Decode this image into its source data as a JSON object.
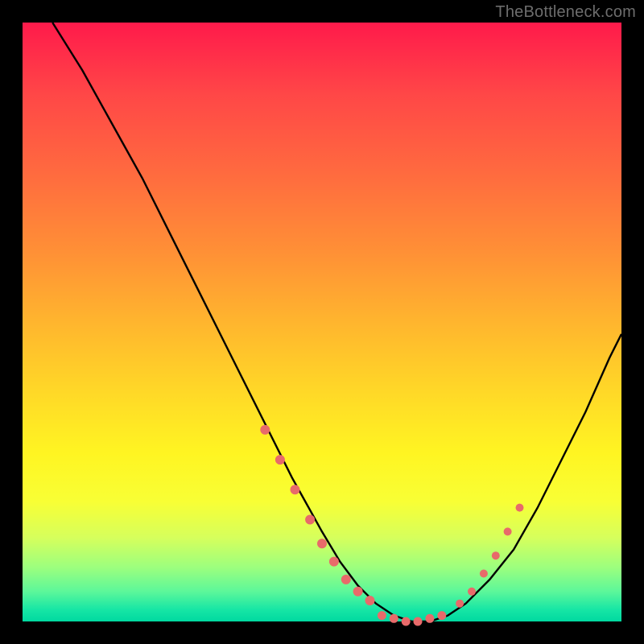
{
  "attribution": "TheBottleneck.com",
  "colors": {
    "page_bg": "#000000",
    "curve_stroke": "#000000",
    "marker_fill": "#e86a6a",
    "gradient_top": "#ff1a4b",
    "gradient_bottom": "#00d9a0"
  },
  "chart_data": {
    "type": "line",
    "title": "",
    "xlabel": "",
    "ylabel": "",
    "xlim": [
      0,
      100
    ],
    "ylim": [
      0,
      100
    ],
    "grid": false,
    "legend": null,
    "series": [
      {
        "name": "bottleneck-curve",
        "x": [
          5,
          10,
          15,
          20,
          25,
          30,
          35,
          40,
          45,
          50,
          53,
          56,
          59,
          62,
          65,
          68,
          71,
          74,
          78,
          82,
          86,
          90,
          94,
          98,
          100
        ],
        "values": [
          100,
          92,
          83,
          74,
          64,
          54,
          44,
          34,
          24,
          15,
          10,
          6,
          3,
          1,
          0,
          0,
          1,
          3,
          7,
          12,
          19,
          27,
          35,
          44,
          48
        ]
      }
    ],
    "markers_left": {
      "x": [
        40.5,
        43,
        45.5,
        48,
        50,
        52,
        54,
        56,
        58
      ],
      "values": [
        32,
        27,
        22,
        17,
        13,
        10,
        7,
        5,
        3.5
      ]
    },
    "markers_right": {
      "x": [
        73,
        75,
        77,
        79,
        81,
        83
      ],
      "values": [
        3,
        5,
        8,
        11,
        15,
        19
      ]
    },
    "floor_dots": {
      "x": [
        60,
        62,
        64,
        66,
        68,
        70
      ],
      "values": [
        1,
        0.5,
        0,
        0,
        0.5,
        1
      ]
    }
  }
}
